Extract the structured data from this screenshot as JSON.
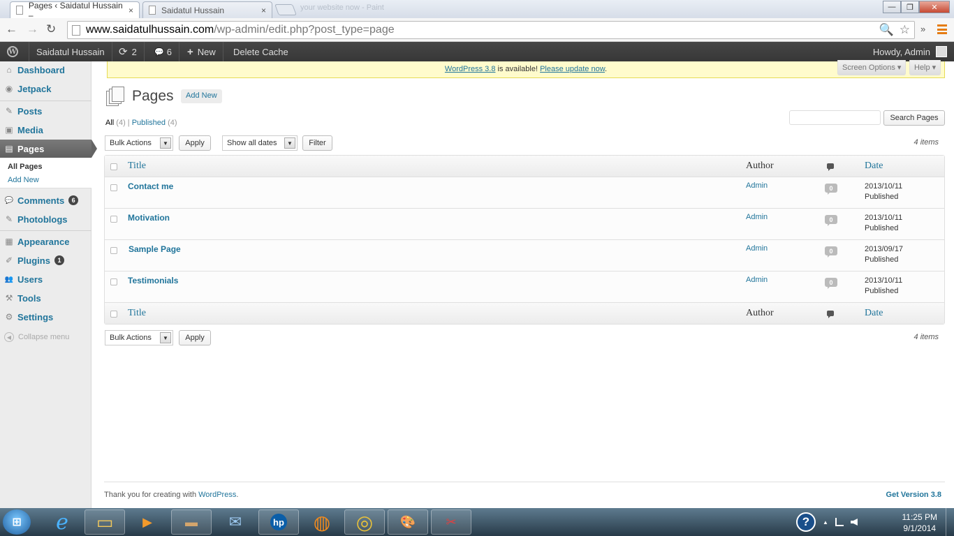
{
  "browser": {
    "tabs": [
      {
        "label": "Pages ‹ Saidatul Hussain –",
        "close": "×"
      },
      {
        "label": "Saidatul Hussain",
        "close": "×"
      }
    ],
    "blurred_tab_text": "your website now - Paint",
    "window_buttons": {
      "minimize": "—",
      "maximize": "❐",
      "close": "✕"
    },
    "nav": {
      "back": "←",
      "forward": "→",
      "reload": "↻"
    },
    "url_host": "www.saidatulhussain.com",
    "url_path": "/wp-admin/edit.php?post_type=page",
    "search_icon": "🔍",
    "star_icon": "☆",
    "overflow": "»"
  },
  "adminbar": {
    "logo": "W",
    "site_name": "Saidatul Hussain",
    "updates_icon": "⟳",
    "updates_count": "2",
    "comments_icon": "💬",
    "comments_count": "6",
    "new_icon": "+",
    "new_label": "New",
    "delete_cache": "Delete Cache",
    "howdy": "Howdy, Admin"
  },
  "sidebar": {
    "items": [
      {
        "label": "Dashboard",
        "icon": "⌂"
      },
      {
        "label": "Jetpack",
        "icon": "◉"
      },
      {
        "label": "Posts",
        "icon": "✎"
      },
      {
        "label": "Media",
        "icon": "▣"
      },
      {
        "label": "Pages",
        "icon": "▤"
      },
      {
        "label": "Comments",
        "icon": "💬",
        "badge": "6"
      },
      {
        "label": "Photoblogs",
        "icon": "✎"
      },
      {
        "label": "Appearance",
        "icon": "▦"
      },
      {
        "label": "Plugins",
        "icon": "✐",
        "badge": "1"
      },
      {
        "label": "Users",
        "icon": "👥"
      },
      {
        "label": "Tools",
        "icon": "⚒"
      },
      {
        "label": "Settings",
        "icon": "⚙"
      }
    ],
    "submenu": {
      "all_pages": "All Pages",
      "add_new": "Add New"
    },
    "collapse_label": "Collapse menu",
    "collapse_icon": "◀"
  },
  "notice": {
    "link1": "WordPress 3.8",
    "middle": " is available! ",
    "link2": "Please update now",
    "end": "."
  },
  "screen_options": "Screen Options ▾",
  "help": "Help ▾",
  "page": {
    "title": "Pages",
    "add_new": "Add New",
    "filters": {
      "all": "All",
      "all_count": " (4)",
      "sep": " | ",
      "published": "Published",
      "published_count": " (4)"
    },
    "search_button": "Search Pages",
    "bulk_actions": "Bulk Actions",
    "apply": "Apply",
    "dates": "Show all dates",
    "filter": "Filter",
    "items_count": "4 items",
    "dropdown_arrow": "▼"
  },
  "table": {
    "columns": {
      "title": "Title",
      "author": "Author",
      "date": "Date"
    },
    "rows": [
      {
        "title": "Contact me",
        "author": "Admin",
        "comments": "0",
        "date": "2013/10/11",
        "status": "Published"
      },
      {
        "title": "Motivation",
        "author": "Admin",
        "comments": "0",
        "date": "2013/10/11",
        "status": "Published"
      },
      {
        "title": "Sample Page",
        "author": "Admin",
        "comments": "0",
        "date": "2013/09/17",
        "status": "Published"
      },
      {
        "title": "Testimonials",
        "author": "Admin",
        "comments": "0",
        "date": "2013/10/11",
        "status": "Published"
      }
    ]
  },
  "footer": {
    "text": "Thank you for creating with ",
    "link": "WordPress",
    "end": ".",
    "version": "Get Version 3.8"
  },
  "taskbar": {
    "start": "⊞",
    "apps": [
      {
        "name": "internet-explorer",
        "glyph": "e"
      },
      {
        "name": "file-explorer",
        "glyph": "▭"
      },
      {
        "name": "media-player",
        "glyph": "▶"
      },
      {
        "name": "app-window",
        "glyph": "▬"
      },
      {
        "name": "thunderbird",
        "glyph": "✉"
      },
      {
        "name": "hp-app",
        "glyph": "hp"
      },
      {
        "name": "firefox",
        "glyph": "◍"
      },
      {
        "name": "chrome",
        "glyph": "◎"
      },
      {
        "name": "paint",
        "glyph": "🎨"
      },
      {
        "name": "snipping-tool",
        "glyph": "✂"
      }
    ],
    "help": "?",
    "tray_arrow": "▲",
    "time": "11:25 PM",
    "date": "9/1/2014"
  },
  "colors": {
    "link": "#21759b",
    "adminbar": "#464646",
    "notice_bg": "#fffbcc",
    "chrome_menu": "#e57c13"
  }
}
